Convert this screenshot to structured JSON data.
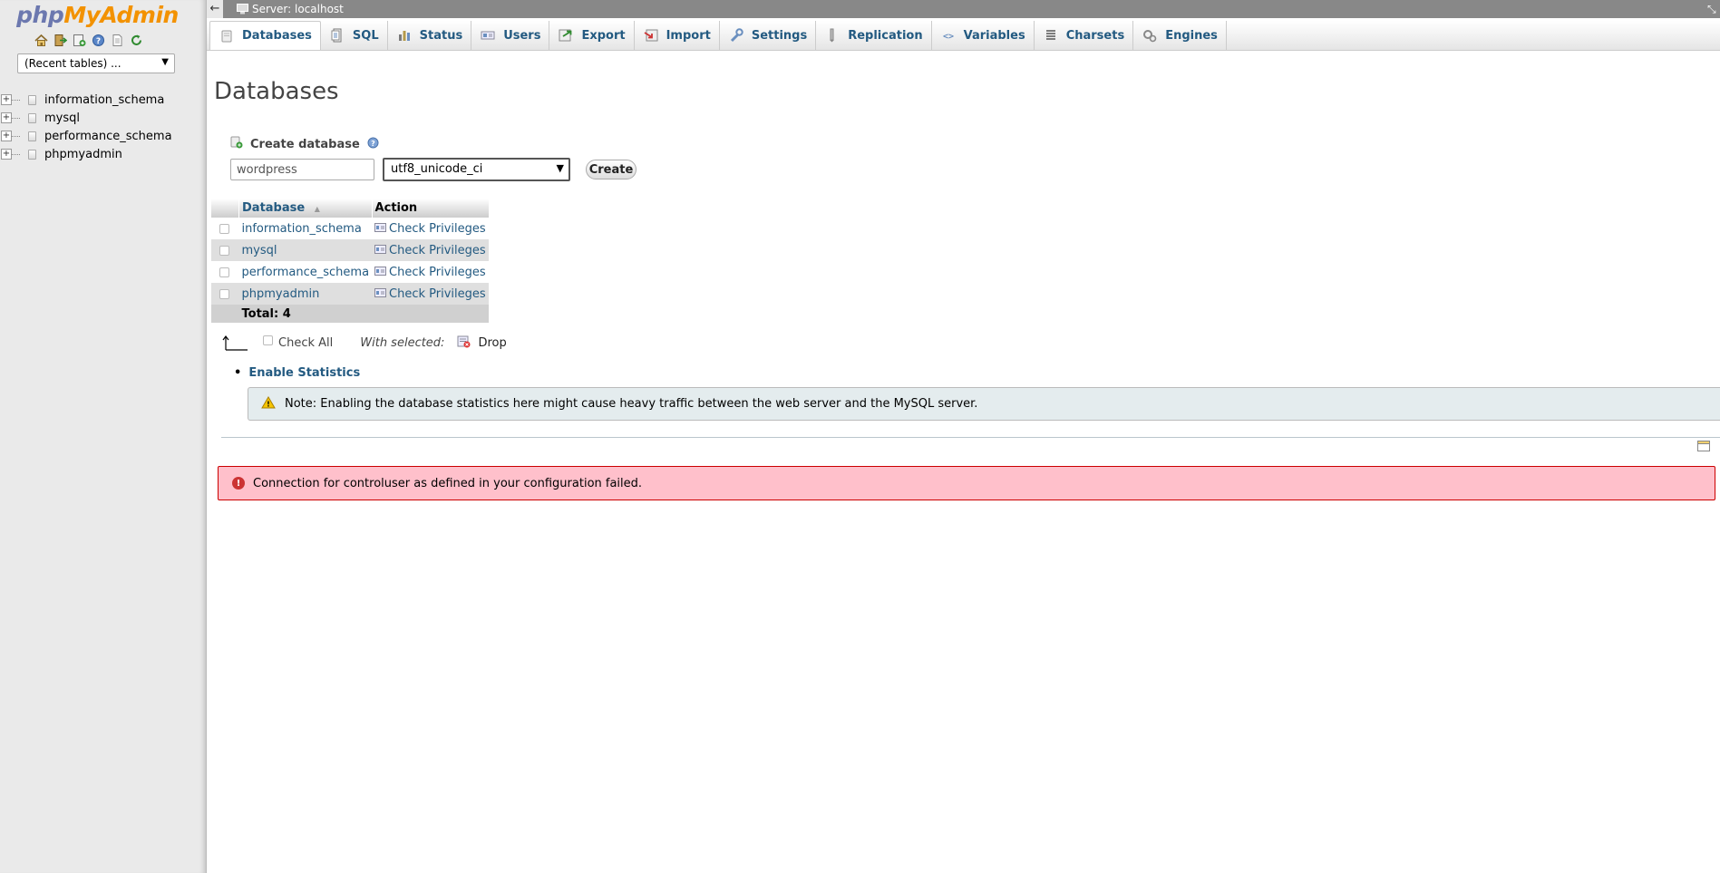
{
  "logo": {
    "part1": "php",
    "part2": "MyAdmin"
  },
  "nav_icons": [
    "home-icon",
    "logout-icon",
    "query-window-icon",
    "documentation-icon",
    "docs-page-icon",
    "reload-icon"
  ],
  "recent_tables": {
    "selected": "(Recent tables) ..."
  },
  "db_tree": [
    "information_schema",
    "mysql",
    "performance_schema",
    "phpmyadmin"
  ],
  "server_bar": {
    "back": "←",
    "title": "Server: localhost",
    "close": "⤡"
  },
  "tabs": [
    {
      "label": "Databases",
      "icon": "database-icon",
      "active": true
    },
    {
      "label": "SQL",
      "icon": "sql-icon"
    },
    {
      "label": "Status",
      "icon": "status-icon"
    },
    {
      "label": "Users",
      "icon": "users-icon"
    },
    {
      "label": "Export",
      "icon": "export-icon"
    },
    {
      "label": "Import",
      "icon": "import-icon"
    },
    {
      "label": "Settings",
      "icon": "settings-icon"
    },
    {
      "label": "Replication",
      "icon": "replication-icon"
    },
    {
      "label": "Variables",
      "icon": "variables-icon"
    },
    {
      "label": "Charsets",
      "icon": "charsets-icon"
    },
    {
      "label": "Engines",
      "icon": "engines-icon"
    }
  ],
  "page_title": "Databases",
  "create_db": {
    "label": "Create database",
    "name_value": "wordpress",
    "collation_selected": "utf8_unicode_ci",
    "button": "Create"
  },
  "table": {
    "headers": {
      "database": "Database",
      "action": "Action"
    },
    "sort_indicator": "▲",
    "rows": [
      {
        "name": "information_schema",
        "action": "Check Privileges"
      },
      {
        "name": "mysql",
        "action": "Check Privileges"
      },
      {
        "name": "performance_schema",
        "action": "Check Privileges"
      },
      {
        "name": "phpmyadmin",
        "action": "Check Privileges"
      }
    ],
    "total": "Total: 4"
  },
  "bulk": {
    "check_all": "Check All",
    "with_selected": "With selected:",
    "drop": "Drop"
  },
  "enable_stats": "Enable Statistics",
  "notice": "Note: Enabling the database statistics here might cause heavy traffic between the web server and the MySQL server.",
  "error": "Connection for controluser as defined in your configuration failed.",
  "colors": {
    "link": "#235a81",
    "logo_php": "#6c78af",
    "logo_myadmin": "#f39200",
    "error_bg": "#ffc0cb",
    "error_border": "#cc0000",
    "notice_bg": "#e4ecee"
  }
}
